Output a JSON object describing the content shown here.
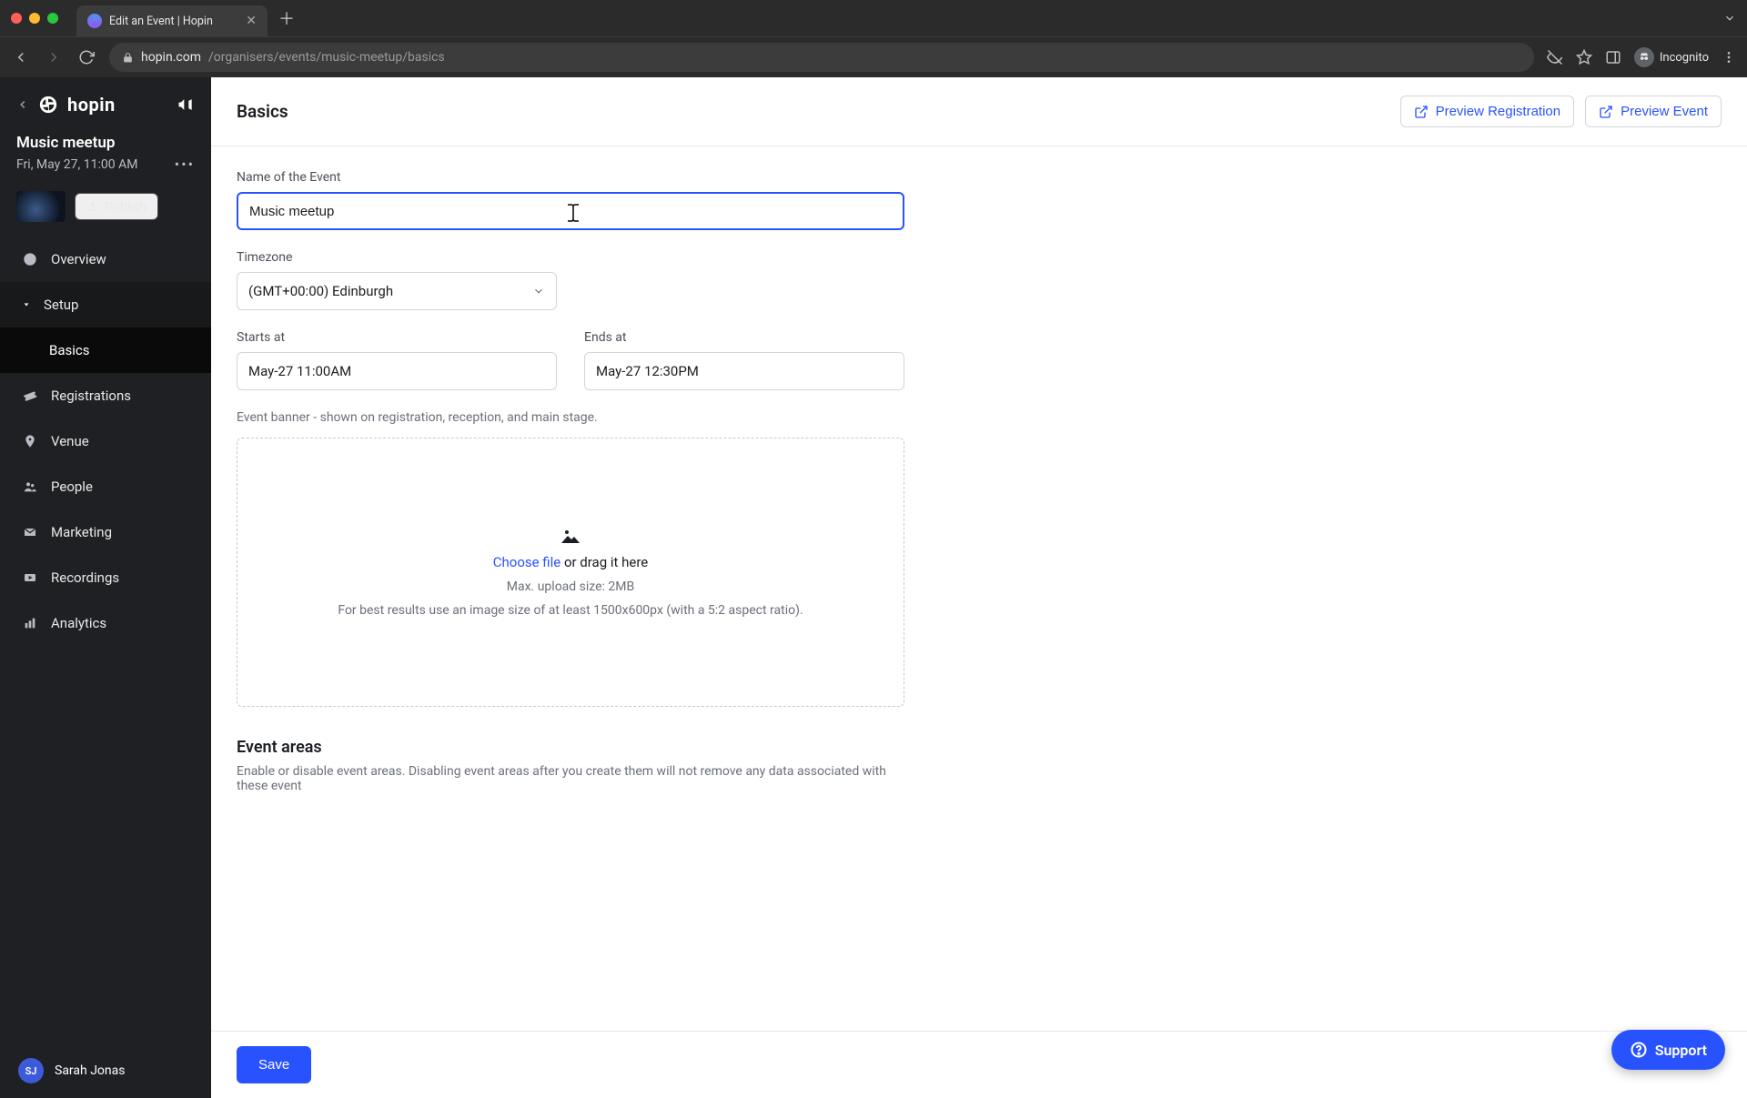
{
  "browser": {
    "tab_title": "Edit an Event | Hopin",
    "url_host": "hopin.com",
    "url_path": "/organisers/events/music-meetup/basics",
    "incognito_label": "Incognito"
  },
  "sidebar": {
    "brand": "hopin",
    "event_name": "Music meetup",
    "event_date": "Fri, May 27, 11:00 AM",
    "publish_label": "Publish",
    "nav": {
      "overview": "Overview",
      "setup": "Setup",
      "basics": "Basics",
      "registrations": "Registrations",
      "venue": "Venue",
      "people": "People",
      "marketing": "Marketing",
      "recordings": "Recordings",
      "analytics": "Analytics"
    },
    "user": {
      "initials": "SJ",
      "name": "Sarah Jonas"
    }
  },
  "header": {
    "title": "Basics",
    "preview_registration": "Preview Registration",
    "preview_event": "Preview Event"
  },
  "form": {
    "name_label": "Name of the Event",
    "name_value": "Music meetup",
    "timezone_label": "Timezone",
    "timezone_value": "(GMT+00:00) Edinburgh",
    "starts_label": "Starts at",
    "starts_value": "May-27 11:00AM",
    "ends_label": "Ends at",
    "ends_value": "May-27 12:30PM",
    "banner_helper": "Event banner - shown on registration, reception, and main stage.",
    "dropzone": {
      "choose": "Choose file",
      "drag": " or drag it here",
      "max": "Max. upload size: 2MB",
      "hint": "For best results use an image size of at least 1500x600px (with a 5:2 aspect ratio)."
    },
    "areas_title": "Event areas",
    "areas_desc": "Enable or disable event areas. Disabling event areas after you create them will not remove any data associated with these event"
  },
  "footer": {
    "save": "Save"
  },
  "support": {
    "label": "Support"
  }
}
